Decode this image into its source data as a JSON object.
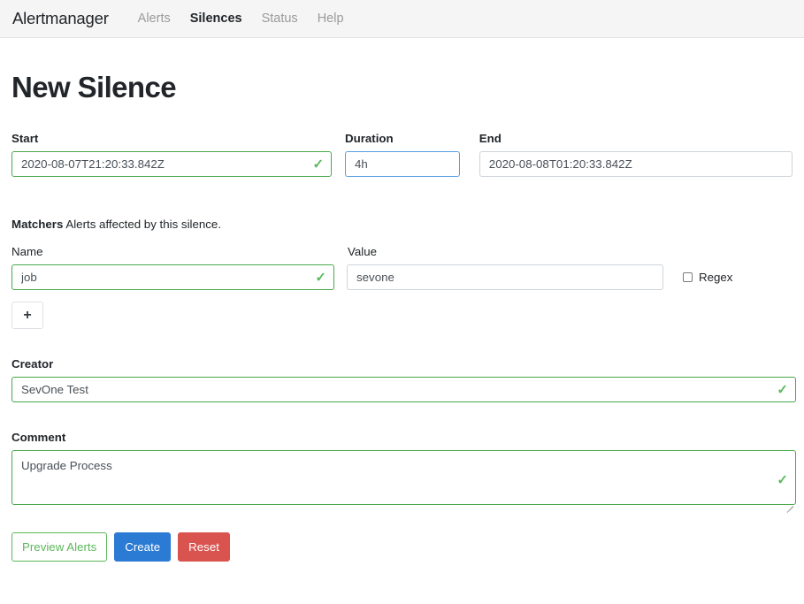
{
  "navbar": {
    "brand": "Alertmanager",
    "links": [
      {
        "label": "Alerts",
        "active": false
      },
      {
        "label": "Silences",
        "active": true
      },
      {
        "label": "Status",
        "active": false
      },
      {
        "label": "Help",
        "active": false
      }
    ]
  },
  "page": {
    "title": "New Silence"
  },
  "schedule": {
    "start": {
      "label": "Start",
      "value": "2020-08-07T21:20:33.842Z",
      "state": "valid"
    },
    "duration": {
      "label": "Duration",
      "value": "4h",
      "state": "focused"
    },
    "end": {
      "label": "End",
      "value": "2020-08-08T01:20:33.842Z",
      "state": "default"
    }
  },
  "matchers": {
    "heading": "Matchers",
    "description": "Alerts affected by this silence.",
    "name_label": "Name",
    "value_label": "Value",
    "rows": [
      {
        "name": "job",
        "name_state": "valid",
        "value": "sevone",
        "value_state": "default",
        "regex_label": "Regex",
        "regex_checked": false
      }
    ],
    "add_label": "+"
  },
  "creator": {
    "label": "Creator",
    "value": "SevOne Test",
    "state": "valid"
  },
  "comment": {
    "label": "Comment",
    "value": "Upgrade Process",
    "state": "valid"
  },
  "actions": {
    "preview": "Preview Alerts",
    "create": "Create",
    "reset": "Reset"
  },
  "icons": {
    "check": "✓",
    "valid_color": "#5cb85c",
    "primary_color": "#2b7ad4",
    "danger_color": "#d9534f"
  }
}
